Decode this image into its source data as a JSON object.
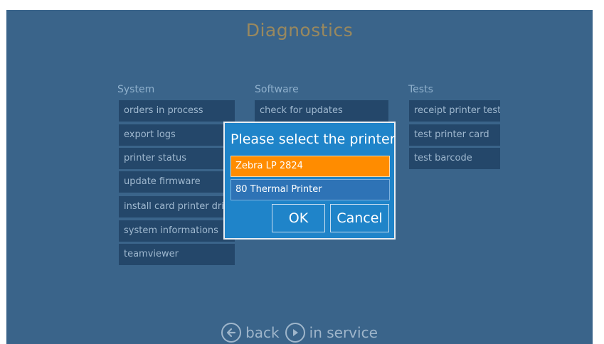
{
  "screen": {
    "title": "Diagnostics"
  },
  "system": {
    "header": "System",
    "buttons": [
      "orders in process",
      "export logs",
      "printer status",
      "update firmware",
      "install card printer driv",
      "system informations",
      "teamviewer"
    ]
  },
  "software": {
    "header": "Software",
    "buttons": [
      "check for updates"
    ]
  },
  "tests": {
    "header": "Tests",
    "buttons": [
      "receipt printer test",
      "test printer card",
      "test barcode"
    ]
  },
  "dialog": {
    "title": "Please select the printer",
    "options": [
      "Zebra LP 2824",
      "80 Thermal Printer"
    ],
    "selected_option": "Zebra LP 2824",
    "ok_label": "OK",
    "cancel_label": "Cancel"
  },
  "footer": {
    "back_label": "back",
    "in_service_label": "in service",
    "back_icon": "arrow-left-circle-icon",
    "in_service_icon": "play-circle-icon"
  },
  "colors": {
    "background": "#3a648a",
    "button": "#24476a",
    "dialog": "#1f84c9",
    "selected": "#ff8c00",
    "title": "#d9a142"
  }
}
